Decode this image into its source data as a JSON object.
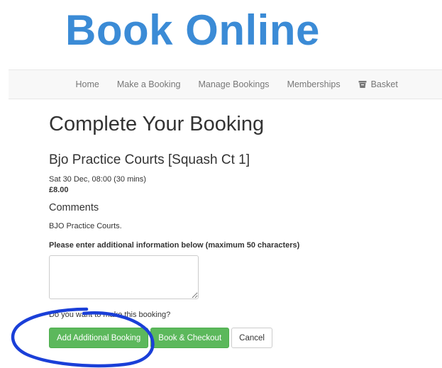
{
  "header": {
    "title": "Book Online"
  },
  "nav": {
    "items": [
      {
        "label": "Home"
      },
      {
        "label": "Make a Booking"
      },
      {
        "label": "Manage Bookings"
      },
      {
        "label": "Memberships"
      },
      {
        "label": "Basket",
        "icon": "basket-icon"
      }
    ]
  },
  "main": {
    "heading": "Complete Your Booking",
    "venue": "Bjo Practice Courts [Squash Ct 1]",
    "slot": "Sat 30 Dec, 08:00 (30 mins)",
    "price": "£8.00",
    "comments_heading": "Comments",
    "comments_text": "BJO Practice Courts.",
    "info_label": "Please enter additional information below (maximum 50 characters)",
    "info_value": "",
    "question": "Do you want to make this booking?",
    "buttons": {
      "add_additional": "Add Additional Booking",
      "book_checkout": "Book & Checkout",
      "cancel": "Cancel"
    }
  },
  "colors": {
    "title_blue": "#3b8bd6",
    "success_green": "#5cb85c",
    "annotation_blue": "#1a3fd8"
  }
}
